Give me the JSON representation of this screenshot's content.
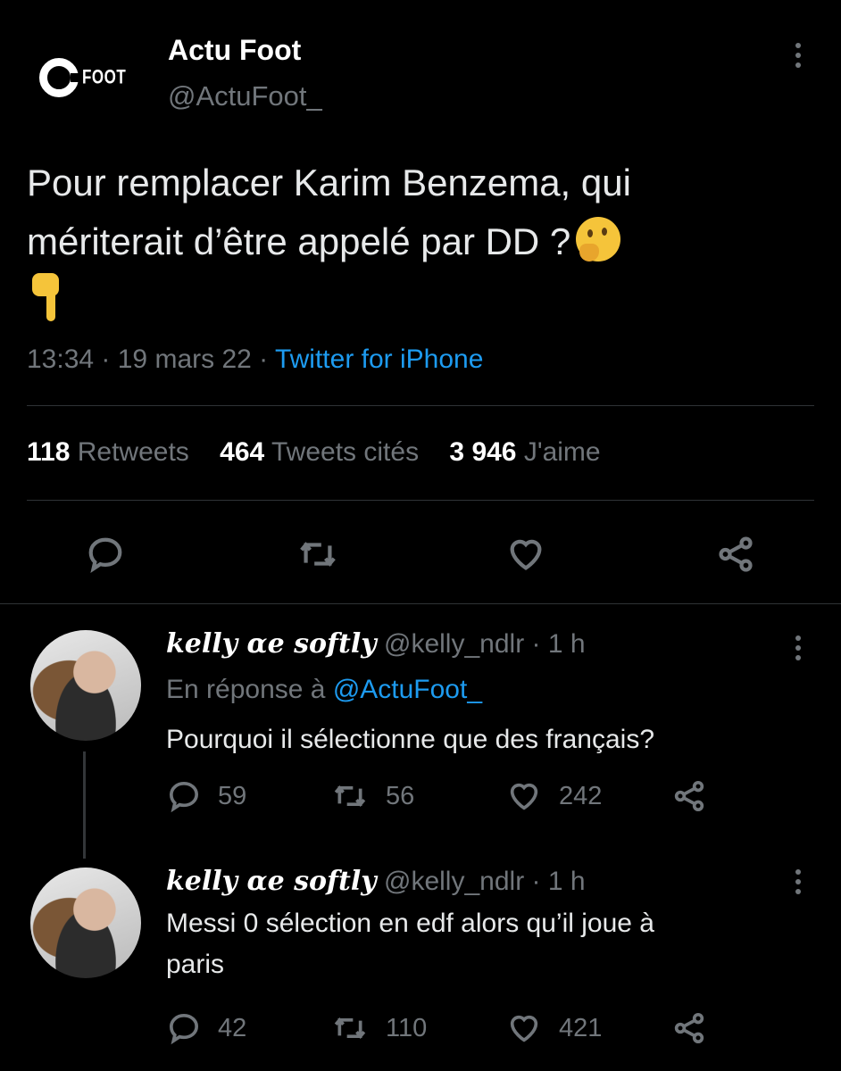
{
  "main_tweet": {
    "logo_text": "FOOT",
    "author_name": "Actu Foot",
    "author_handle": "@ActuFoot_",
    "text_line1": "Pour remplacer Karim Benzema, qui",
    "text_line2": "mériterait d’être appelé par DD ?",
    "time": "13:34",
    "date": "19 mars 22",
    "source": "Twitter for iPhone",
    "stats": {
      "retweets_count": "118",
      "retweets_label": "Retweets",
      "quotes_count": "464",
      "quotes_label": "Tweets cités",
      "likes_count": "3 946",
      "likes_label": "J'aime"
    }
  },
  "replies": [
    {
      "display_name": "kelly ɑe softly",
      "handle": "@kelly_ndlr",
      "age": "1 h",
      "reply_to_label": "En réponse à",
      "reply_to_handle": "@ActuFoot_",
      "text": "Pourquoi il sélectionne que des français?",
      "replies": "59",
      "retweets": "56",
      "likes": "242"
    },
    {
      "display_name": "kelly ɑe softly",
      "handle": "@kelly_ndlr",
      "age": "1 h",
      "text_line1": "Messi 0 sélection en edf alors qu’il joue à",
      "text_line2": "paris",
      "replies": "42",
      "retweets": "110",
      "likes": "421"
    }
  ],
  "colors": {
    "background": "#000000",
    "text": "#e7e9ea",
    "secondary": "#71767b",
    "link": "#1d9bf0",
    "divider": "#2f3336"
  }
}
